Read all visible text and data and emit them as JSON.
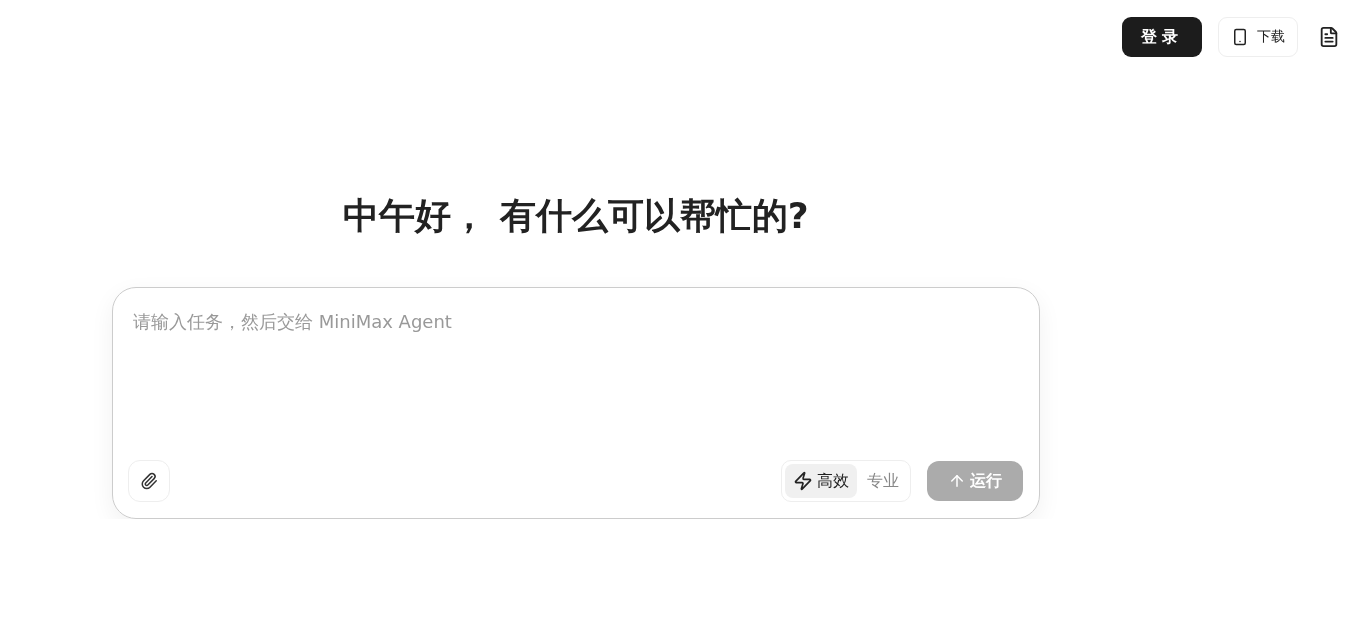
{
  "header": {
    "login_button": "登录",
    "download_button": "下载"
  },
  "greeting": "中午好， 有什么可以帮忙的?",
  "composer": {
    "placeholder": "请输入任务，然后交给 MiniMax Agent",
    "modes": [
      {
        "label": "高效",
        "kind": "fast",
        "selected": true
      },
      {
        "label": "专业",
        "kind": "plain",
        "selected": false
      }
    ],
    "run_button": {
      "label": "运行",
      "disabled": true
    }
  }
}
